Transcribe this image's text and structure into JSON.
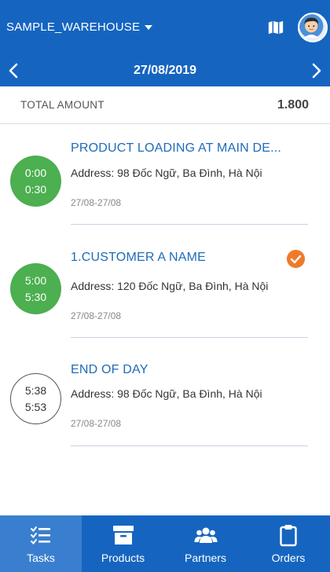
{
  "header": {
    "warehouse": "SAMPLE_WAREHOUSE",
    "map_icon": "map-icon",
    "avatar_icon": "user-avatar",
    "date": "27/08/2019"
  },
  "summary": {
    "label": "TOTAL AMOUNT",
    "value": "1.800"
  },
  "tasks": [
    {
      "start": "0:00",
      "end": "0:30",
      "title": "PRODUCT LOADING AT MAIN DE...",
      "address": "Address: 98 Đốc Ngữ, Ba Đình, Hà Nội",
      "date_range": "27/08-27/08",
      "status": "done",
      "checked": false
    },
    {
      "start": "5:00",
      "end": "5:30",
      "title": "1.CUSTOMER A NAME",
      "address": "Address: 120 Đốc Ngữ, Ba Đình, Hà Nội",
      "date_range": "27/08-27/08",
      "status": "done",
      "checked": true
    },
    {
      "start": "5:38",
      "end": "5:53",
      "title": "END OF DAY",
      "address": "Address: 98 Đốc Ngữ, Ba Đình, Hà Nội",
      "date_range": "27/08-27/08",
      "status": "pending",
      "checked": false
    }
  ],
  "bottom_nav": [
    {
      "label": "Tasks",
      "icon": "tasks-checklist-icon",
      "active": true
    },
    {
      "label": "Products",
      "icon": "box-icon",
      "active": false
    },
    {
      "label": "Partners",
      "icon": "people-group-icon",
      "active": false
    },
    {
      "label": "Orders",
      "icon": "clipboard-icon",
      "active": false
    }
  ],
  "colors": {
    "primary": "#1565c0",
    "active_tab": "#3a7fcf",
    "done": "#4caf50",
    "check": "#ef7b2a",
    "title": "#1e6bb8"
  }
}
